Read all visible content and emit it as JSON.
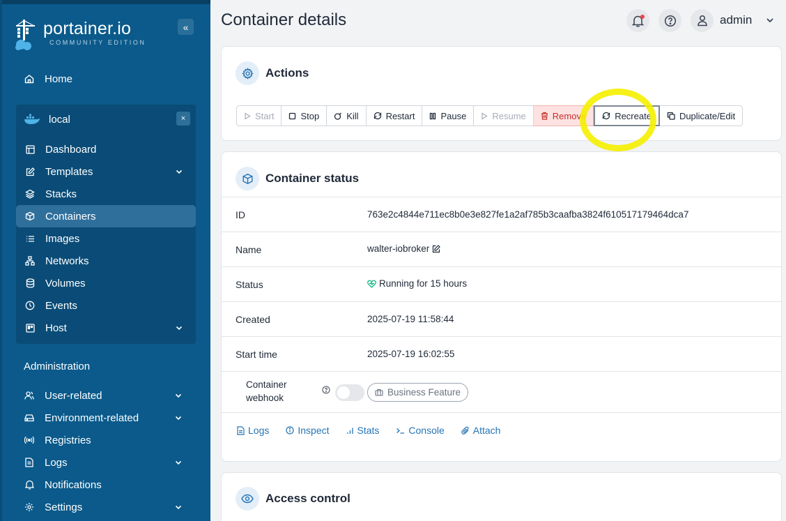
{
  "app": {
    "brand": "portainer.io",
    "edition": "COMMUNITY EDITION",
    "collapse_glyph": "«"
  },
  "sidebar": {
    "home": {
      "label": "Home",
      "icon": "home-icon"
    },
    "environment": {
      "name": "local",
      "icon": "docker-icon",
      "close_glyph": "×"
    },
    "env_items": [
      {
        "label": "Dashboard",
        "icon": "dashboard-icon"
      },
      {
        "label": "Templates",
        "icon": "edit-icon",
        "expandable": true
      },
      {
        "label": "Stacks",
        "icon": "layers-icon"
      },
      {
        "label": "Containers",
        "icon": "box-icon",
        "active": true
      },
      {
        "label": "Images",
        "icon": "list-icon"
      },
      {
        "label": "Networks",
        "icon": "network-icon"
      },
      {
        "label": "Volumes",
        "icon": "database-icon"
      },
      {
        "label": "Events",
        "icon": "clock-icon"
      },
      {
        "label": "Host",
        "icon": "host-icon",
        "expandable": true
      }
    ],
    "admin_heading": "Administration",
    "admin_items": [
      {
        "label": "User-related",
        "icon": "users-icon",
        "expandable": true
      },
      {
        "label": "Environment-related",
        "icon": "drive-icon",
        "expandable": true
      },
      {
        "label": "Registries",
        "icon": "radio-icon"
      },
      {
        "label": "Logs",
        "icon": "file-icon",
        "expandable": true
      },
      {
        "label": "Notifications",
        "icon": "bell-icon"
      },
      {
        "label": "Settings",
        "icon": "gear-icon",
        "expandable": true
      }
    ]
  },
  "header": {
    "title": "Container details",
    "user": "admin"
  },
  "actions": {
    "title": "Actions",
    "buttons": [
      {
        "label": "Start",
        "state": "disabled"
      },
      {
        "label": "Stop",
        "state": "normal"
      },
      {
        "label": "Kill",
        "state": "normal"
      },
      {
        "label": "Restart",
        "state": "normal"
      },
      {
        "label": "Pause",
        "state": "normal"
      },
      {
        "label": "Resume",
        "state": "disabled"
      },
      {
        "label": "Remove",
        "state": "danger"
      },
      {
        "label": "Recreate",
        "state": "normal"
      },
      {
        "label": "Duplicate/Edit",
        "state": "normal"
      }
    ]
  },
  "status": {
    "title": "Container status",
    "rows": [
      {
        "label": "ID",
        "value": "763e2c4844e711ec8b0e3e827fe1a2af785b3caafba3824f610517179464dca7"
      },
      {
        "label": "Name",
        "value": "walter-iobroker"
      },
      {
        "label": "Status",
        "value": "Running for 15 hours"
      },
      {
        "label": "Created",
        "value": "2025-07-19 11:58:44"
      },
      {
        "label": "Start time",
        "value": "2025-07-19 16:02:55"
      }
    ],
    "webhook_label_1": "Container",
    "webhook_label_2": "webhook",
    "business_feature": "Business Feature",
    "links": [
      "Logs",
      "Inspect",
      "Stats",
      "Console",
      "Attach"
    ]
  },
  "access_control": {
    "title": "Access control"
  },
  "colors": {
    "sidebar": "#0b5a8b",
    "accent": "#2574b5",
    "danger": "#c5302b",
    "highlight": "#f5ef00",
    "running": "#10b981"
  }
}
